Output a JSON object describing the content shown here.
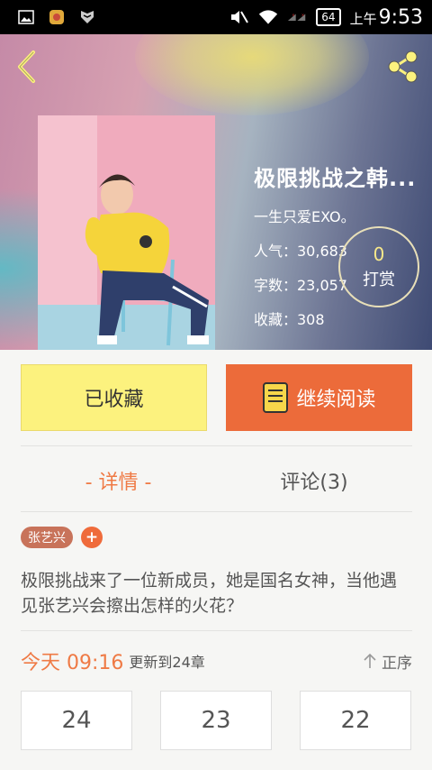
{
  "status_bar": {
    "battery": "64",
    "time_prefix": "上午",
    "time": "9:53"
  },
  "book": {
    "title": "极限挑战之韩...",
    "author": "一生只爱EXO。",
    "popularity": "人气：30,683",
    "words": "字数：23,057",
    "favorites": "收藏：308",
    "tip_count": "0",
    "tip_label": "打赏"
  },
  "actions": {
    "collected": "已收藏",
    "continue": "继续阅读"
  },
  "tabs": {
    "details": "- 详情 -",
    "comments": "评论(3)"
  },
  "tags": {
    "tag1": "张艺兴",
    "add": "+"
  },
  "description": "极限挑战来了一位新成员，她是国名女神，当他遇见张艺兴会擦出怎样的火花？",
  "update": {
    "today": "今天 09:16",
    "text": "更新到24章",
    "sort": "正序"
  },
  "chapters": [
    "24",
    "23",
    "22"
  ],
  "colors": {
    "accent": "#ec6b3a",
    "collected_bg": "#fcf27e",
    "tag_bg": "#c8735a"
  },
  "icons": [
    "image-icon",
    "app-icon",
    "shield-icon",
    "mute-icon",
    "wifi-icon",
    "signal-icon",
    "back-icon",
    "share-icon",
    "book-icon",
    "sort-up-icon"
  ]
}
